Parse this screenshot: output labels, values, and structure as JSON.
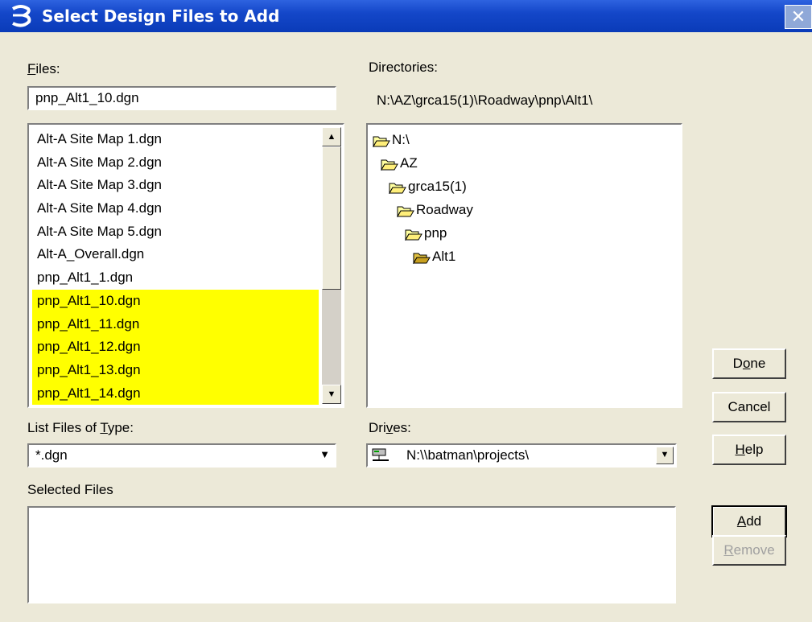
{
  "window": {
    "title": "Select Design Files to Add",
    "close_symbol": "✕",
    "icon": "microstation-app-icon"
  },
  "files": {
    "label_pre": "",
    "label_key": "F",
    "label_post": "iles:",
    "filename_value": "pnp_Alt1_10.dgn",
    "items": [
      {
        "name": "Alt-A Site Map 1.dgn",
        "selected": false
      },
      {
        "name": "Alt-A Site Map 2.dgn",
        "selected": false
      },
      {
        "name": "Alt-A Site Map 3.dgn",
        "selected": false
      },
      {
        "name": "Alt-A Site Map 4.dgn",
        "selected": false
      },
      {
        "name": "Alt-A Site Map 5.dgn",
        "selected": false
      },
      {
        "name": "Alt-A_Overall.dgn",
        "selected": false
      },
      {
        "name": "pnp_Alt1_1.dgn",
        "selected": false
      },
      {
        "name": "pnp_Alt1_10.dgn",
        "selected": true
      },
      {
        "name": "pnp_Alt1_11.dgn",
        "selected": true
      },
      {
        "name": "pnp_Alt1_12.dgn",
        "selected": true
      },
      {
        "name": "pnp_Alt1_13.dgn",
        "selected": true
      },
      {
        "name": "pnp_Alt1_14.dgn",
        "selected": true
      }
    ],
    "highlight_color": "#ffff00"
  },
  "directories": {
    "label": "Directories:",
    "current_path": "N:\\AZ\\grca15(1)\\Roadway\\pnp\\Alt1\\",
    "tree": [
      "N:\\",
      "AZ",
      "grca15(1)",
      "Roadway",
      "pnp",
      "Alt1"
    ]
  },
  "file_type": {
    "label_pre": "List Files of ",
    "label_key": "T",
    "label_post": "ype:",
    "value": "*.dgn"
  },
  "drives": {
    "label_pre": "Dri",
    "label_key": "v",
    "label_post": "es:",
    "value": "N:\\\\batman\\projects\\",
    "icon": "network-drive-icon"
  },
  "selected_files": {
    "label": "Selected Files"
  },
  "buttons": {
    "done": {
      "pre": "D",
      "key": "o",
      "post": "ne"
    },
    "cancel": {
      "label": "Cancel"
    },
    "help": {
      "pre": "",
      "key": "H",
      "post": "elp"
    },
    "add": {
      "pre": "",
      "key": "A",
      "post": "dd"
    },
    "remove": {
      "pre": "",
      "key": "R",
      "post": "emove",
      "enabled": false
    }
  }
}
